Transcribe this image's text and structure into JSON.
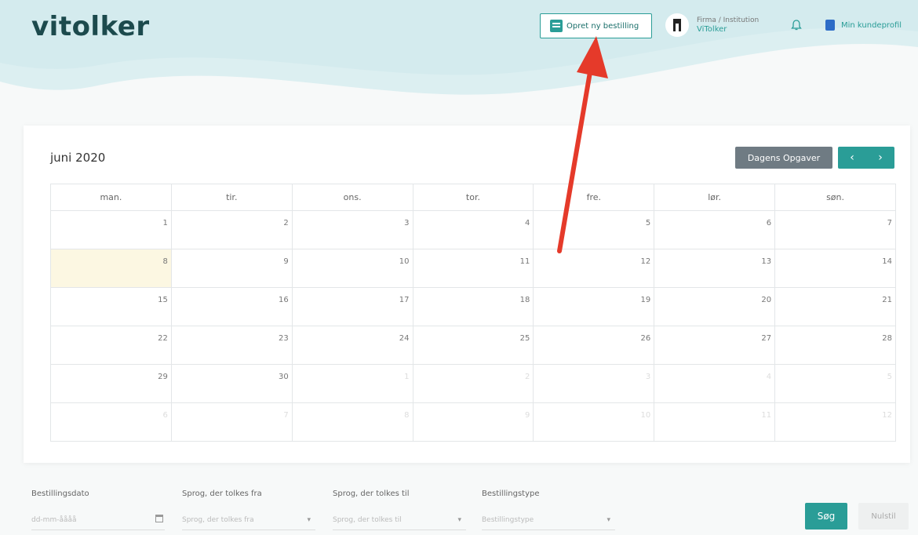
{
  "header": {
    "logo_text": "vitolker",
    "new_order_label": "Opret ny bestilling",
    "firm_label": "Firma / Institution",
    "firm_name": "ViTolker",
    "profile_label": "Min kundeprofil"
  },
  "calendar": {
    "month_title": "juni 2020",
    "today_button": "Dagens Opgaver",
    "prev_label": "‹",
    "next_label": "›",
    "weekdays": [
      "man.",
      "tir.",
      "ons.",
      "tor.",
      "fre.",
      "lør.",
      "søn."
    ],
    "weeks": [
      [
        {
          "d": "1"
        },
        {
          "d": "2"
        },
        {
          "d": "3"
        },
        {
          "d": "4"
        },
        {
          "d": "5"
        },
        {
          "d": "6"
        },
        {
          "d": "7"
        }
      ],
      [
        {
          "d": "8",
          "today": true
        },
        {
          "d": "9"
        },
        {
          "d": "10"
        },
        {
          "d": "11"
        },
        {
          "d": "12"
        },
        {
          "d": "13"
        },
        {
          "d": "14"
        }
      ],
      [
        {
          "d": "15"
        },
        {
          "d": "16"
        },
        {
          "d": "17"
        },
        {
          "d": "18"
        },
        {
          "d": "19"
        },
        {
          "d": "20"
        },
        {
          "d": "21"
        }
      ],
      [
        {
          "d": "22"
        },
        {
          "d": "23"
        },
        {
          "d": "24"
        },
        {
          "d": "25"
        },
        {
          "d": "26"
        },
        {
          "d": "27"
        },
        {
          "d": "28"
        }
      ],
      [
        {
          "d": "29"
        },
        {
          "d": "30"
        },
        {
          "d": "1",
          "other": true
        },
        {
          "d": "2",
          "other": true
        },
        {
          "d": "3",
          "other": true
        },
        {
          "d": "4",
          "other": true
        },
        {
          "d": "5",
          "other": true
        }
      ],
      [
        {
          "d": "6",
          "other": true
        },
        {
          "d": "7",
          "other": true
        },
        {
          "d": "8",
          "other": true
        },
        {
          "d": "9",
          "other": true
        },
        {
          "d": "10",
          "other": true
        },
        {
          "d": "11",
          "other": true
        },
        {
          "d": "12",
          "other": true
        }
      ]
    ]
  },
  "filters": {
    "date_label": "Bestillingsdato",
    "date_value": "dd-mm-åååå",
    "lang_from_label": "Sprog, der tolkes fra",
    "lang_from_placeholder": "Sprog, der tolkes fra",
    "lang_to_label": "Sprog, der tolkes til",
    "lang_to_placeholder": "Sprog, der tolkes til",
    "type_label": "Bestillingstype",
    "type_placeholder": "Bestillingstype",
    "search_button": "Søg",
    "reset_button": "Nulstil"
  },
  "colors": {
    "accent": "#2a9d97",
    "today_highlight": "#fcf7e2",
    "annotation_arrow": "#e53a2a"
  }
}
